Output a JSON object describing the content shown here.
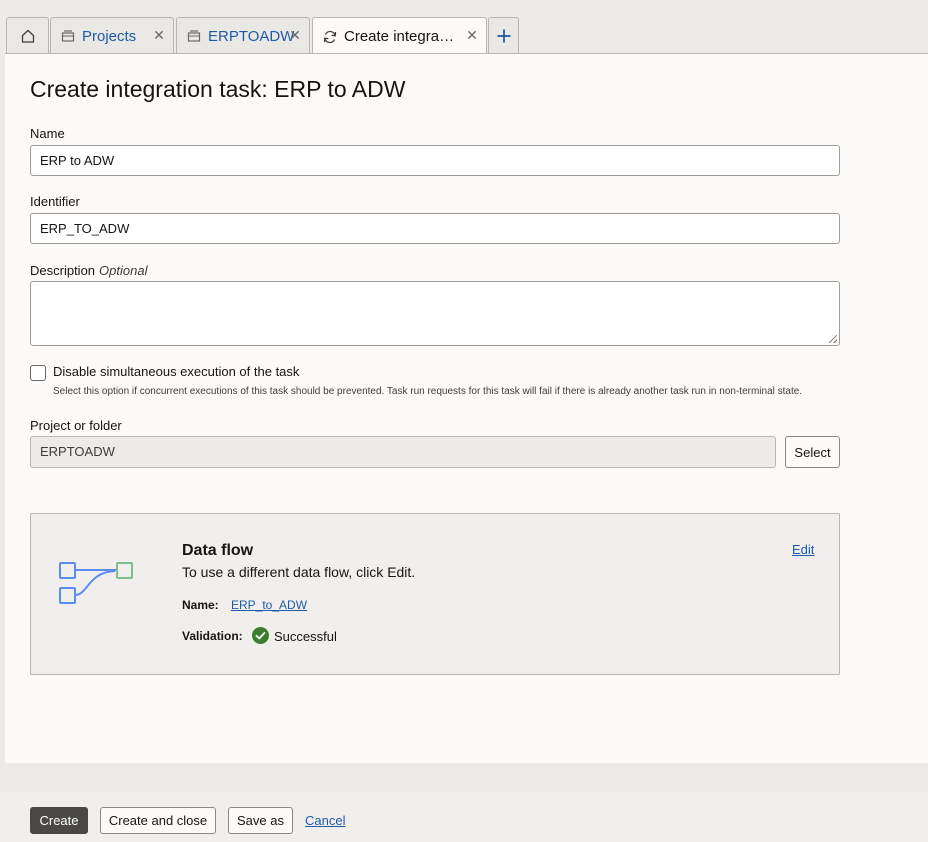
{
  "tabs": [
    {
      "label": "",
      "icon": "home-icon"
    },
    {
      "label": "Projects",
      "icon": "project-icon"
    },
    {
      "label": "ERPTOADW",
      "icon": "project-icon"
    },
    {
      "label": "Create integrati...",
      "icon": "refresh-icon"
    }
  ],
  "page": {
    "title": "Create integration task: ERP to ADW"
  },
  "form": {
    "name_label": "Name",
    "name_value": "ERP to ADW",
    "identifier_label": "Identifier",
    "identifier_value": "ERP_TO_ADW",
    "description_label": "Description",
    "description_optional": "Optional",
    "description_value": "",
    "disable_label": "Disable simultaneous execution of the task",
    "disable_help": "Select this option if concurrent executions of this task should be prevented. Task run requests for this task will fail if there is already another task run in non-terminal state.",
    "disable_checked": false,
    "project_label": "Project or folder",
    "project_value": "ERPTOADW",
    "select_label": "Select"
  },
  "dataflow": {
    "title": "Data flow",
    "subtitle": "To use a different data flow, click Edit.",
    "edit_label": "Edit",
    "name_label": "Name:",
    "name_value": "ERP_to_ADW",
    "validation_label": "Validation:",
    "validation_value": "Successful",
    "validation_color": "#3c7e2f"
  },
  "footer": {
    "create_label": "Create",
    "create_close_label": "Create and close",
    "save_as_label": "Save as",
    "cancel_label": "Cancel"
  },
  "colors": {
    "accent": "#1f5ba8",
    "primary_button": "#4a4845",
    "illustration_blue": "#5b8def",
    "illustration_green": "#7cc08c"
  }
}
